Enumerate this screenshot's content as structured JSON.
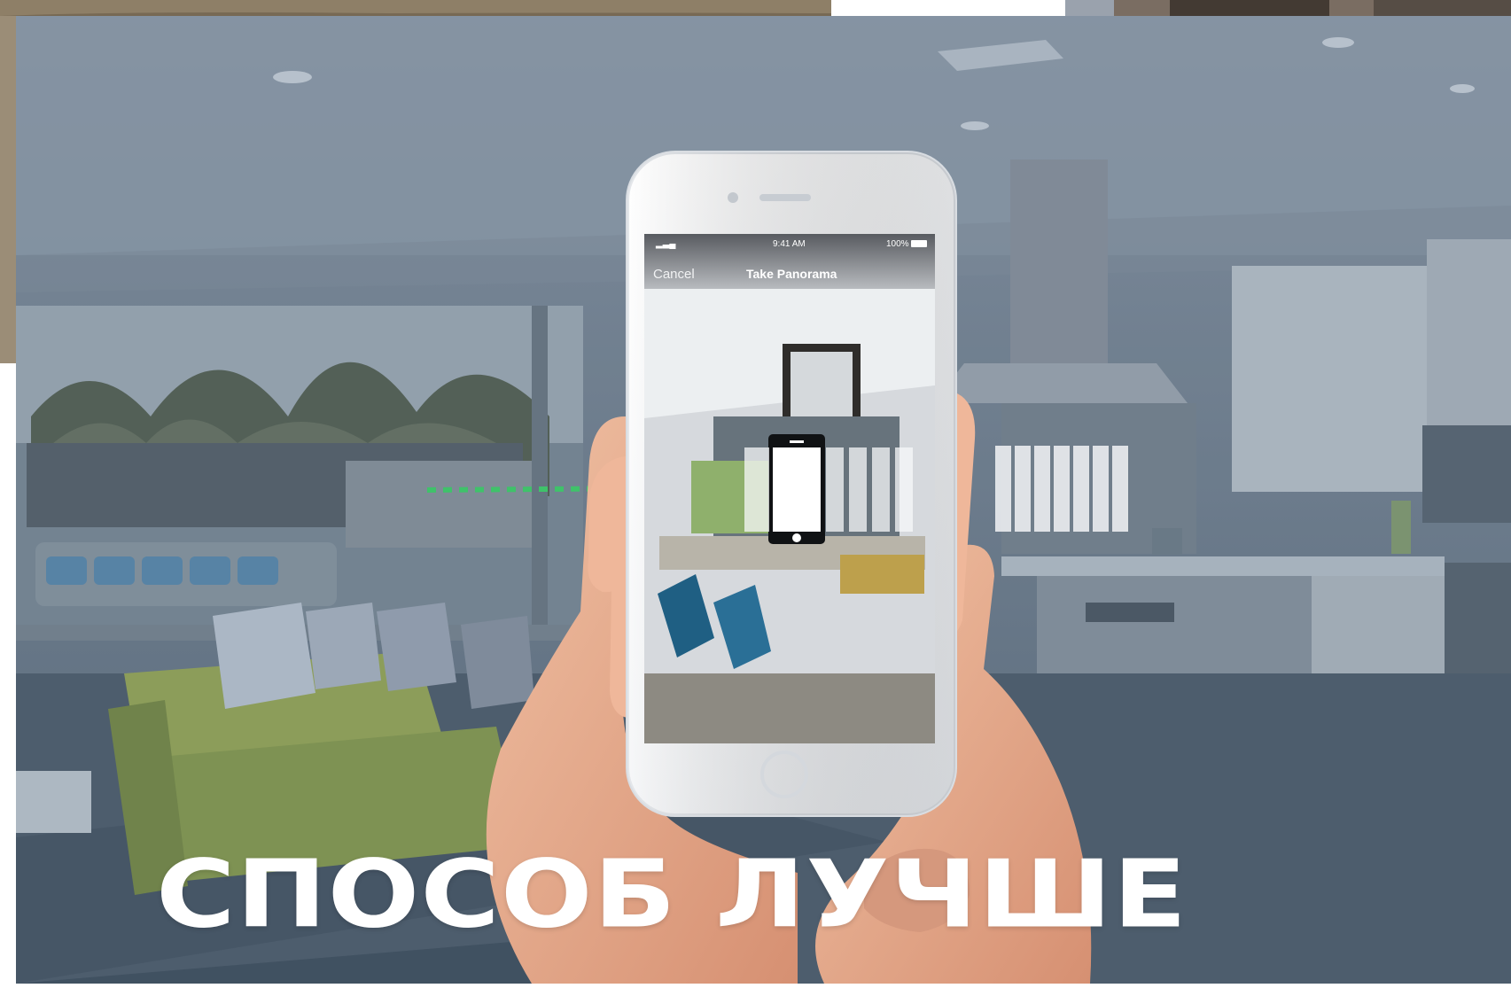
{
  "headline": "СПОСОБ ЛУЧШЕ",
  "phone_screen": {
    "time": "9:41 AM",
    "battery": "100%",
    "cancel_label": "Cancel",
    "title": "Take Panorama"
  },
  "colors": {
    "overlay": "#4b6076",
    "headline": "#ffffff",
    "guide_line": "#3fc26a"
  },
  "icons": [
    "phone-outline-icon"
  ]
}
